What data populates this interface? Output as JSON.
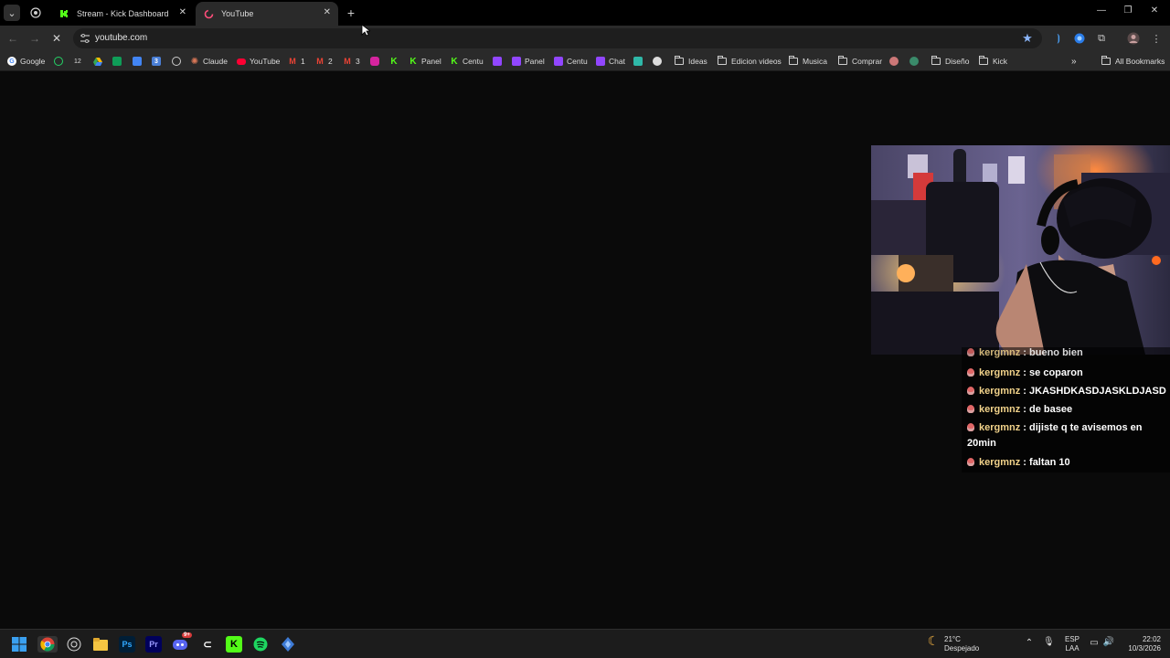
{
  "tabs": [
    {
      "title": "Stream - Kick Dashboard",
      "active": false
    },
    {
      "title": "YouTube",
      "active": true
    }
  ],
  "toolbar": {
    "url": "youtube.com"
  },
  "bookmarks": {
    "items": [
      {
        "label": "Google",
        "icon": "google-icon"
      },
      {
        "label": "",
        "icon": "whatsapp-icon"
      },
      {
        "label": "12",
        "icon": "number-badge"
      },
      {
        "label": "",
        "icon": "drive-icon"
      },
      {
        "label": "",
        "icon": "sheets-icon"
      },
      {
        "label": "",
        "icon": "docs-icon"
      },
      {
        "label": "",
        "icon": "calendar-icon"
      },
      {
        "label": "",
        "icon": "chatgpt-icon"
      },
      {
        "label": "Claude",
        "icon": "claude-icon"
      },
      {
        "label": "YouTube",
        "icon": "youtube-icon"
      },
      {
        "label": "1",
        "icon": "gmail-icon"
      },
      {
        "label": "2",
        "icon": "gmail-icon"
      },
      {
        "label": "3",
        "icon": "gmail-icon"
      },
      {
        "label": "",
        "icon": "instagram-icon"
      },
      {
        "label": "",
        "icon": "kick-icon"
      },
      {
        "label": "Panel",
        "icon": "kick-icon"
      },
      {
        "label": "Centu",
        "icon": "kick-icon"
      },
      {
        "label": "",
        "icon": "twitch-icon"
      },
      {
        "label": "Panel",
        "icon": "twitch-icon"
      },
      {
        "label": "Centu",
        "icon": "twitch-icon"
      },
      {
        "label": "Chat",
        "icon": "twitch-icon"
      },
      {
        "label": "",
        "icon": "app-icon"
      },
      {
        "label": "",
        "icon": "reddit-icon"
      },
      {
        "label": "Ideas",
        "icon": "folder-icon"
      },
      {
        "label": "Edicion videos",
        "icon": "folder-icon"
      },
      {
        "label": "Musica",
        "icon": "folder-icon"
      },
      {
        "label": "Comprar",
        "icon": "folder-icon"
      },
      {
        "label": "",
        "icon": "extension-icon"
      },
      {
        "label": "",
        "icon": "app-icon"
      },
      {
        "label": "Diseño",
        "icon": "folder-icon"
      },
      {
        "label": "Kick",
        "icon": "folder-icon"
      }
    ],
    "overflow": "»",
    "all_bookmarks": "All Bookmarks"
  },
  "chat": {
    "messages": [
      {
        "user": "kergmnz",
        "text": "bueno bien"
      },
      {
        "user": "kergmnz",
        "text": "se coparon"
      },
      {
        "user": "kergmnz",
        "text": "JKASHDKASDJASKLDJASD"
      },
      {
        "user": "kergmnz",
        "text": "de basee"
      },
      {
        "user": "kergmnz",
        "text": "dijiste q te avisemos en 20min"
      },
      {
        "user": "kergmnz",
        "text": "faltan 10"
      }
    ],
    "separator": " : "
  },
  "taskbar": {
    "weather_temp": "21°C",
    "weather_desc": "Despejado",
    "lang": "ESP",
    "layout": "LAA",
    "time": "22:02",
    "date": "10/3/2026",
    "notification_badge": "9+"
  },
  "colors": {
    "kick_green": "#53fc18",
    "twitch_purple": "#9146ff",
    "chat_user": "#f1d28a",
    "youtube_red": "#ff0033"
  }
}
